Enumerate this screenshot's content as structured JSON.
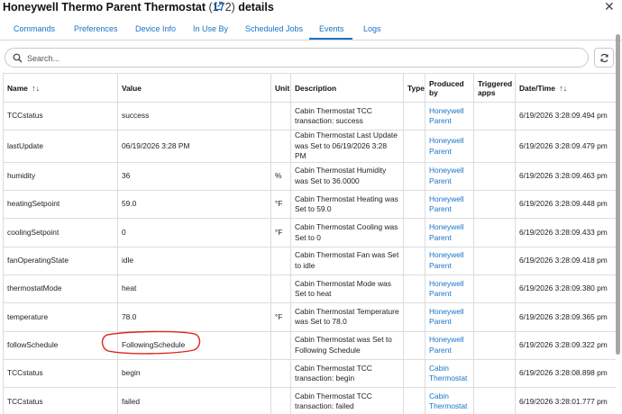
{
  "header": {
    "title": "Honeywell Thermo Parent Thermostat",
    "count": "(172)",
    "title_suffix": "details"
  },
  "tabs": [
    {
      "label": "Commands"
    },
    {
      "label": "Preferences"
    },
    {
      "label": "Device Info"
    },
    {
      "label": "In Use By"
    },
    {
      "label": "Scheduled Jobs"
    },
    {
      "label": "Events",
      "active": true
    },
    {
      "label": "Logs"
    }
  ],
  "search": {
    "placeholder": "Search...",
    "value": ""
  },
  "table": {
    "headers": {
      "name": "Name",
      "value": "Value",
      "unit": "Unit",
      "description": "Description",
      "type": "Type",
      "produced_by": "Produced by",
      "triggered_apps": "Triggered apps",
      "datetime": "Date/Time"
    },
    "rows": [
      {
        "name": "TCCstatus",
        "value": "success",
        "unit": "",
        "description": "Cabin Thermostat TCC transaction: success",
        "type": "",
        "produced_by": "Honeywell Parent",
        "triggered_apps": "",
        "datetime": "6/19/2026 3:28:09.494 pm"
      },
      {
        "name": "lastUpdate",
        "value": "06/19/2026 3:28 PM",
        "unit": "",
        "description": "Cabin Thermostat Last Update was Set to 06/19/2026 3:28 PM",
        "type": "",
        "produced_by": "Honeywell Parent",
        "triggered_apps": "",
        "datetime": "6/19/2026 3:28:09.479 pm"
      },
      {
        "name": "humidity",
        "value": "36",
        "unit": "%",
        "description": "Cabin Thermostat Humidity was Set to 36.0000",
        "type": "",
        "produced_by": "Honeywell Parent",
        "triggered_apps": "",
        "datetime": "6/19/2026 3:28:09.463 pm"
      },
      {
        "name": "heatingSetpoint",
        "value": "59.0",
        "unit": "°F",
        "description": "Cabin Thermostat Heating was Set to 59.0",
        "type": "",
        "produced_by": "Honeywell Parent",
        "triggered_apps": "",
        "datetime": "6/19/2026 3:28:09.448 pm"
      },
      {
        "name": "coolingSetpoint",
        "value": "0",
        "unit": "°F",
        "description": "Cabin Thermostat Cooling was Set to 0",
        "type": "",
        "produced_by": "Honeywell Parent",
        "triggered_apps": "",
        "datetime": "6/19/2026 3:28:09.433 pm"
      },
      {
        "name": "fanOperatingState",
        "value": "idle",
        "unit": "",
        "description": "Cabin Thermostat Fan was Set to idle",
        "type": "",
        "produced_by": "Honeywell Parent",
        "triggered_apps": "",
        "datetime": "6/19/2026 3:28:09.418 pm"
      },
      {
        "name": "thermostatMode",
        "value": "heat",
        "unit": "",
        "description": "Cabin Thermostat Mode was Set to heat",
        "type": "",
        "produced_by": "Honeywell Parent",
        "triggered_apps": "",
        "datetime": "6/19/2026 3:28:09.380 pm"
      },
      {
        "name": "temperature",
        "value": "78.0",
        "unit": "°F",
        "description": "Cabin Thermostat Temperature was Set to 78.0",
        "type": "",
        "produced_by": "Honeywell Parent",
        "triggered_apps": "",
        "datetime": "6/19/2026 3:28:09.365 pm"
      },
      {
        "name": "followSchedule",
        "value": "FollowingSchedule",
        "unit": "",
        "description": "Cabin Thermostat was Set to Following Schedule",
        "type": "",
        "produced_by": "Honeywell Parent",
        "triggered_apps": "",
        "datetime": "6/19/2026 3:28:09.322 pm"
      },
      {
        "name": "TCCstatus",
        "value": "begin",
        "unit": "",
        "description": "Cabin Thermostat TCC transaction: begin",
        "type": "",
        "produced_by": "Cabin Thermostat",
        "triggered_apps": "",
        "datetime": "6/19/2026 3:28:08.898 pm"
      },
      {
        "name": "TCCstatus",
        "value": "failed",
        "unit": "",
        "description": "Cabin Thermostat TCC transaction: failed",
        "type": "",
        "produced_by": "Cabin Thermostat",
        "triggered_apps": "",
        "datetime": "6/19/2026 3:28:01.777 pm"
      }
    ]
  },
  "colors": {
    "link": "#1a73c8",
    "highlight_annotation": "#d9261c"
  },
  "icons": [
    "external-link-icon",
    "close-icon",
    "search-icon",
    "refresh-icon",
    "sort-icon"
  ]
}
